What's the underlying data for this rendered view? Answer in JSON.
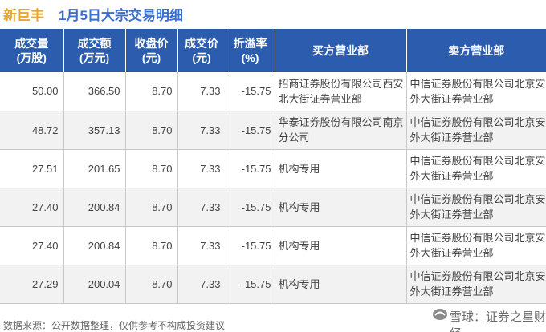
{
  "title": {
    "stock": "新巨丰",
    "rest": "1月5日大宗交易明细"
  },
  "columns": [
    "成交量\n(万股)",
    "成交额\n(万元)",
    "收盘价\n(元)",
    "成交价\n(元)",
    "折溢率\n(%)",
    "买方营业部",
    "卖方营业部"
  ],
  "rows": [
    {
      "volume": "50.00",
      "amount": "366.50",
      "close": "8.70",
      "price": "7.33",
      "premium": "-15.75",
      "buyer": "招商证券股份有限公司西安北大街证券营业部",
      "seller": "中信证券股份有限公司北京安外大街证券营业部"
    },
    {
      "volume": "48.72",
      "amount": "357.13",
      "close": "8.70",
      "price": "7.33",
      "premium": "-15.75",
      "buyer": "华泰证券股份有限公司南京分公司",
      "seller": "中信证券股份有限公司北京安外大街证券营业部"
    },
    {
      "volume": "27.51",
      "amount": "201.65",
      "close": "8.70",
      "price": "7.33",
      "premium": "-15.75",
      "buyer": "机构专用",
      "seller": "中信证券股份有限公司北京安外大街证券营业部"
    },
    {
      "volume": "27.40",
      "amount": "200.84",
      "close": "8.70",
      "price": "7.33",
      "premium": "-15.75",
      "buyer": "机构专用",
      "seller": "中信证券股份有限公司北京安外大街证券营业部"
    },
    {
      "volume": "27.40",
      "amount": "200.84",
      "close": "8.70",
      "price": "7.33",
      "premium": "-15.75",
      "buyer": "机构专用",
      "seller": "中信证券股份有限公司北京安外大街证券营业部"
    },
    {
      "volume": "27.29",
      "amount": "200.04",
      "close": "8.70",
      "price": "7.33",
      "premium": "-15.75",
      "buyer": "机构专用",
      "seller": "中信证券股份有限公司北京安外大街证券营业部"
    }
  ],
  "footer": "数据来源：公开数据整理，仅供参考不构成投资建议",
  "brand": "雪球：证券之星财经",
  "colors": {
    "header_bg": "#2b5cad",
    "title_stock": "#e8a530",
    "title_rest": "#3a6fd0",
    "premium": "#2e9a3c"
  },
  "icons": [
    "snowball-logo-icon"
  ]
}
